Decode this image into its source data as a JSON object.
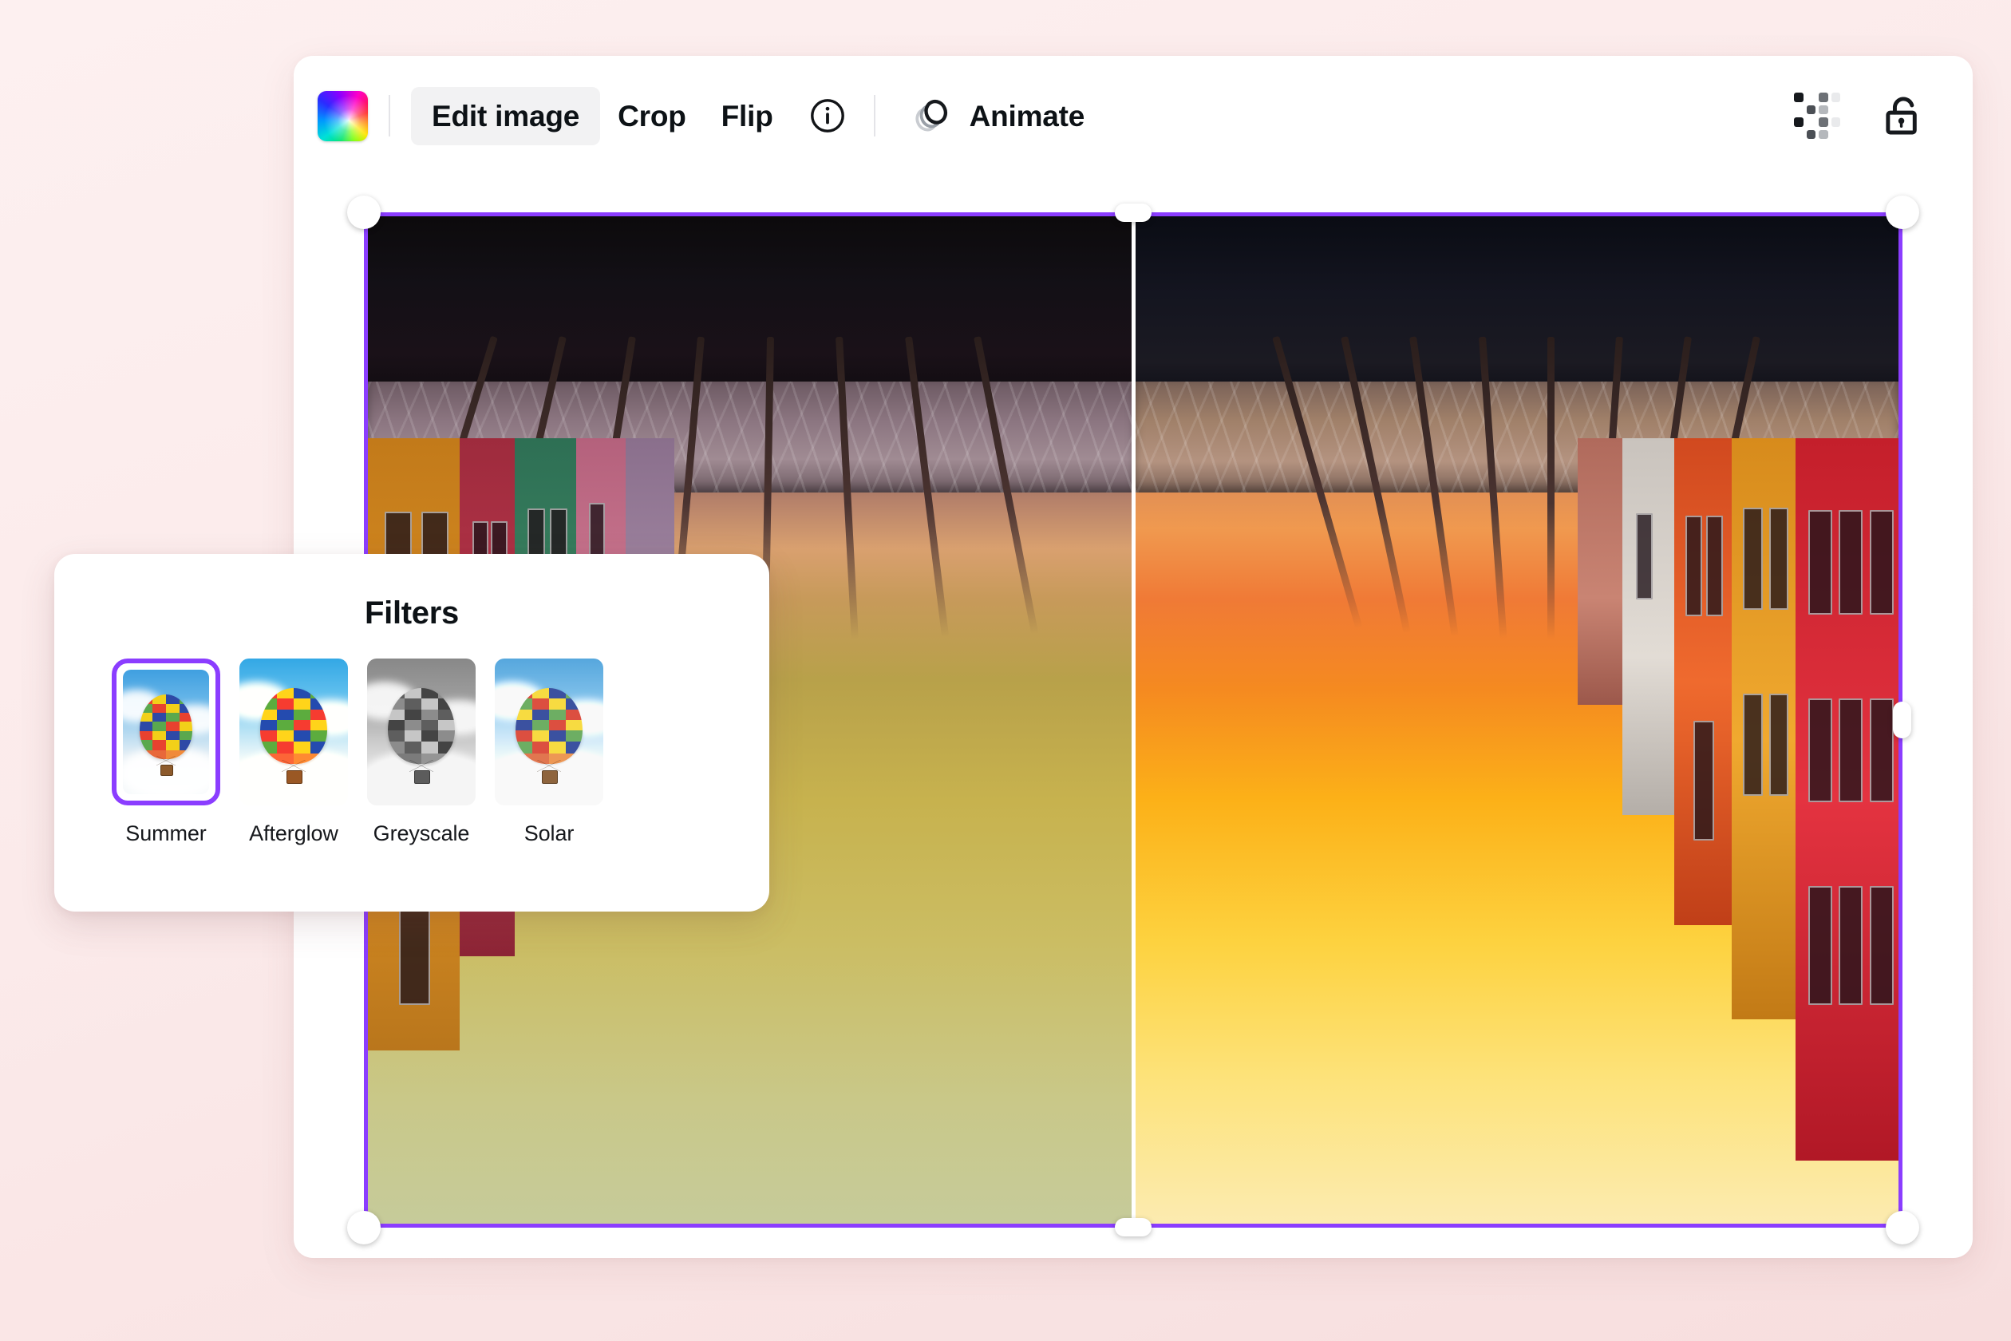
{
  "theme": {
    "page_background": "#fbeaea",
    "accent_purple": "#8b3dff",
    "card_background": "#ffffff",
    "text_primary": "#0d1216",
    "toolbar_active_background": "#f2f2f3"
  },
  "toolbar": {
    "color_swatch": "rainbow-gradient-swatch",
    "items": [
      {
        "id": "edit-image",
        "label": "Edit image",
        "active": true
      },
      {
        "id": "crop",
        "label": "Crop",
        "active": false
      },
      {
        "id": "flip",
        "label": "Flip",
        "active": false
      }
    ],
    "info_icon": "info-circle-icon",
    "animate": {
      "label": "Animate",
      "icon": "animate-circles-icon"
    },
    "right_icons": [
      {
        "id": "transparency",
        "icon": "checkerboard-transparency-icon"
      },
      {
        "id": "lock",
        "icon": "unlock-icon"
      }
    ]
  },
  "canvas": {
    "selection": {
      "border_color": "#8b3dff",
      "handles": [
        "top-left",
        "top-center",
        "top-right",
        "right-center",
        "bottom-left",
        "bottom-center",
        "bottom-right"
      ]
    },
    "image": {
      "alt": "Upside-down colourful canal houses at sunset, split preview",
      "split_divider": true
    }
  },
  "filters_panel": {
    "title": "Filters",
    "filters": [
      {
        "id": "summer",
        "label": "Summer",
        "selected": true,
        "thumb_style": "normal"
      },
      {
        "id": "afterglow",
        "label": "Afterglow",
        "selected": false,
        "thumb_style": "afterglow"
      },
      {
        "id": "greyscale",
        "label": "Greyscale",
        "selected": false,
        "thumb_style": "greyscale"
      },
      {
        "id": "solar",
        "label": "Solar",
        "selected": false,
        "thumb_style": "solar"
      }
    ]
  }
}
